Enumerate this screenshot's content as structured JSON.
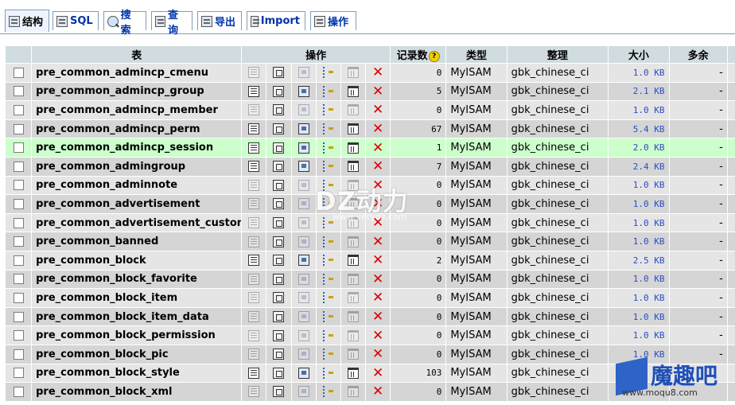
{
  "tabs": [
    {
      "label": "结构",
      "icon": "structure-icon",
      "active": true
    },
    {
      "label": "SQL",
      "icon": "sql-icon",
      "active": false
    },
    {
      "label": "搜索",
      "icon": "search-icon",
      "active": false
    },
    {
      "label": "查询",
      "icon": "query-icon",
      "active": false
    },
    {
      "label": "导出",
      "icon": "export-icon",
      "active": false
    },
    {
      "label": "Import",
      "icon": "import-icon",
      "active": false
    },
    {
      "label": "操作",
      "icon": "operations-icon",
      "active": false
    }
  ],
  "table": {
    "headers": {
      "table": "表",
      "actions": "操作",
      "records": "记录数",
      "type": "类型",
      "collation": "整理",
      "size": "大小",
      "overhead": "多余"
    },
    "rows": [
      {
        "name": "pre_common_admincp_cmenu",
        "records": "0",
        "type": "MyISAM",
        "collation": "gbk_chinese_ci",
        "size": "1.0 KB",
        "overhead": "-",
        "has_data": false
      },
      {
        "name": "pre_common_admincp_group",
        "records": "5",
        "type": "MyISAM",
        "collation": "gbk_chinese_ci",
        "size": "2.1 KB",
        "overhead": "-",
        "has_data": true
      },
      {
        "name": "pre_common_admincp_member",
        "records": "0",
        "type": "MyISAM",
        "collation": "gbk_chinese_ci",
        "size": "1.0 KB",
        "overhead": "-",
        "has_data": false
      },
      {
        "name": "pre_common_admincp_perm",
        "records": "67",
        "type": "MyISAM",
        "collation": "gbk_chinese_ci",
        "size": "5.4 KB",
        "overhead": "-",
        "has_data": true
      },
      {
        "name": "pre_common_admincp_session",
        "records": "1",
        "type": "MyISAM",
        "collation": "gbk_chinese_ci",
        "size": "2.0 KB",
        "overhead": "-",
        "has_data": true,
        "highlight": true
      },
      {
        "name": "pre_common_admingroup",
        "records": "7",
        "type": "MyISAM",
        "collation": "gbk_chinese_ci",
        "size": "2.4 KB",
        "overhead": "-",
        "has_data": true
      },
      {
        "name": "pre_common_adminnote",
        "records": "0",
        "type": "MyISAM",
        "collation": "gbk_chinese_ci",
        "size": "1.0 KB",
        "overhead": "-",
        "has_data": false
      },
      {
        "name": "pre_common_advertisement",
        "records": "0",
        "type": "MyISAM",
        "collation": "gbk_chinese_ci",
        "size": "1.0 KB",
        "overhead": "-",
        "has_data": false
      },
      {
        "name": "pre_common_advertisement_custom",
        "records": "0",
        "type": "MyISAM",
        "collation": "gbk_chinese_ci",
        "size": "1.0 KB",
        "overhead": "-",
        "has_data": false
      },
      {
        "name": "pre_common_banned",
        "records": "0",
        "type": "MyISAM",
        "collation": "gbk_chinese_ci",
        "size": "1.0 KB",
        "overhead": "-",
        "has_data": false
      },
      {
        "name": "pre_common_block",
        "records": "2",
        "type": "MyISAM",
        "collation": "gbk_chinese_ci",
        "size": "2.5 KB",
        "overhead": "-",
        "has_data": true
      },
      {
        "name": "pre_common_block_favorite",
        "records": "0",
        "type": "MyISAM",
        "collation": "gbk_chinese_ci",
        "size": "1.0 KB",
        "overhead": "-",
        "has_data": false
      },
      {
        "name": "pre_common_block_item",
        "records": "0",
        "type": "MyISAM",
        "collation": "gbk_chinese_ci",
        "size": "1.0 KB",
        "overhead": "-",
        "has_data": false
      },
      {
        "name": "pre_common_block_item_data",
        "records": "0",
        "type": "MyISAM",
        "collation": "gbk_chinese_ci",
        "size": "1.0 KB",
        "overhead": "-",
        "has_data": false
      },
      {
        "name": "pre_common_block_permission",
        "records": "0",
        "type": "MyISAM",
        "collation": "gbk_chinese_ci",
        "size": "1.0 KB",
        "overhead": "-",
        "has_data": false
      },
      {
        "name": "pre_common_block_pic",
        "records": "0",
        "type": "MyISAM",
        "collation": "gbk_chinese_ci",
        "size": "1.0 KB",
        "overhead": "-",
        "has_data": false
      },
      {
        "name": "pre_common_block_style",
        "records": "103",
        "type": "MyISAM",
        "collation": "gbk_chinese_ci",
        "size": "",
        "overhead": "",
        "has_data": true
      },
      {
        "name": "pre_common_block_xml",
        "records": "0",
        "type": "MyISAM",
        "collation": "gbk_chinese_ci",
        "size": "",
        "overhead": "",
        "has_data": false
      }
    ]
  },
  "watermark": {
    "title": "DZ动力",
    "url": "www.verydz.com"
  },
  "logo": {
    "title": "魔趣吧",
    "url": "www.moqu8.com"
  }
}
